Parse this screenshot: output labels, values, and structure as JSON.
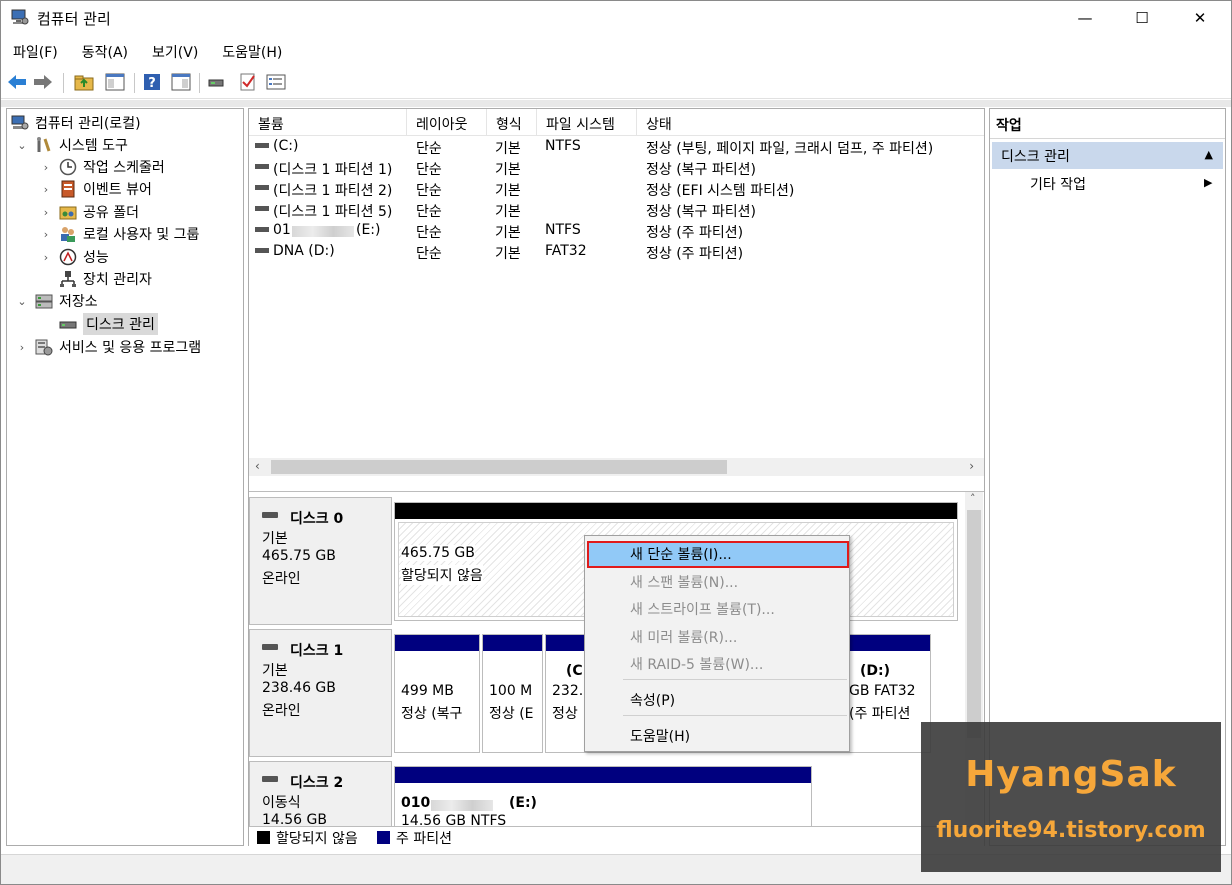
{
  "window": {
    "title": "컴퓨터 관리",
    "min_label": "—",
    "max_label": "☐",
    "close_label": "✕"
  },
  "menu": [
    "파일(F)",
    "동작(A)",
    "보기(V)",
    "도움말(H)"
  ],
  "tree": {
    "root": "컴퓨터 관리(로컬)",
    "system_tools": "시스템 도구",
    "task_scheduler": "작업 스케줄러",
    "event_viewer": "이벤트 뷰어",
    "shared_folders": "공유 폴더",
    "local_users": "로컬 사용자 및 그룹",
    "performance": "성능",
    "device_manager": "장치 관리자",
    "storage": "저장소",
    "disk_management": "디스크 관리",
    "services": "서비스 및 응용 프로그램"
  },
  "volumes": {
    "columns": [
      "볼륨",
      "레이아웃",
      "형식",
      "파일 시스템",
      "상태"
    ],
    "rows": [
      {
        "name": " (C:)",
        "layout": "단순",
        "type": "기본",
        "fs": "NTFS",
        "status": "정상 (부팅, 페이지 파일, 크래시 덤프, 주 파티션)"
      },
      {
        "name": "(디스크 1 파티션 1)",
        "layout": "단순",
        "type": "기본",
        "fs": "",
        "status": "정상 (복구 파티션)"
      },
      {
        "name": "(디스크 1 파티션 2)",
        "layout": "단순",
        "type": "기본",
        "fs": "",
        "status": "정상 (EFI 시스템 파티션)"
      },
      {
        "name": "(디스크 1 파티션 5)",
        "layout": "단순",
        "type": "기본",
        "fs": "",
        "status": "정상 (복구 파티션)"
      },
      {
        "name_prefix": "01",
        "name_suffix": "(E:)",
        "layout": "단순",
        "type": "기본",
        "fs": "NTFS",
        "status": "정상 (주 파티션)"
      },
      {
        "name": "DNA (D:)",
        "layout": "단순",
        "type": "기본",
        "fs": "FAT32",
        "status": "정상 (주 파티션)"
      }
    ]
  },
  "disks": {
    "disk0": {
      "name": "디스크 0",
      "kind": "기본",
      "size": "465.75 GB",
      "state": "온라인",
      "part_size": "465.75 GB",
      "part_status": "할당되지 않음"
    },
    "disk1": {
      "name": "디스크 1",
      "kind": "기본",
      "size": "238.46 GB",
      "state": "온라인",
      "p1_size": "499 MB",
      "p1_status": "정상 (복구",
      "p2_size": "100 M",
      "p2_status": "정상 (E",
      "p3_label": "(C:)",
      "p3_size": "232.3",
      "p3_status": "정상",
      "p4_label": "(D:)",
      "p4_size": "GB FAT32",
      "p4_status": "(주 파티션"
    },
    "disk2": {
      "name": "디스크 2",
      "kind": "이동식",
      "size": "14.56 GB",
      "part_prefix": "010",
      "part_suffix": "(E:)",
      "part_size": "14.56 GB NTFS"
    }
  },
  "legend": {
    "unallocated": "할당되지 않음",
    "primary": "주 파티션"
  },
  "actions": {
    "header": "작업",
    "section": "디스크 관리",
    "more": "기타 작업"
  },
  "context_menu": {
    "new_simple": "새 단순 볼륨(I)...",
    "new_spanned": "새 스팬 볼륨(N)...",
    "new_striped": "새 스트라이프 볼륨(T)...",
    "new_mirror": "새 미러 볼륨(R)...",
    "new_raid5": "새 RAID-5 볼륨(W)...",
    "properties": "속성(P)",
    "help": "도움말(H)"
  },
  "watermark": {
    "name": "HyangSak",
    "url": "fluorite94.tistory.com"
  },
  "colors": {
    "primary_partition": "#00007f",
    "unallocated": "#000000",
    "selection": "#91c9f7",
    "highlight_border": "#e01b1b",
    "watermark": "#f6a73a"
  }
}
